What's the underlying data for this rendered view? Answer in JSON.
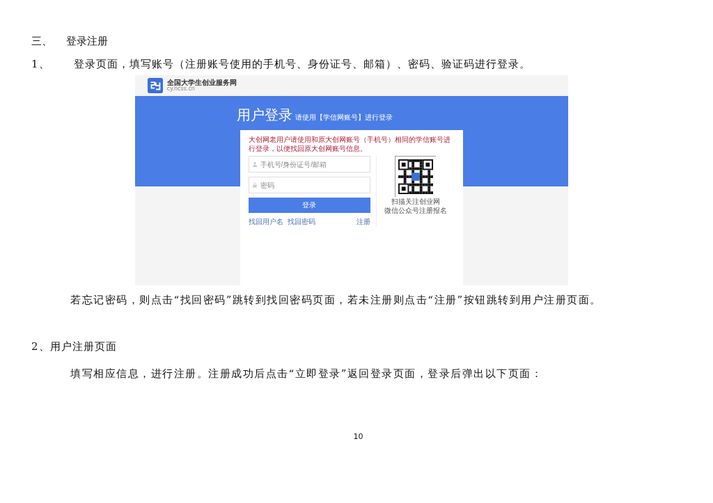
{
  "section": {
    "number": "三、",
    "title": "登录注册"
  },
  "step_1": {
    "number": "1、",
    "text": "登录页面，填写账号（注册账号使用的手机号、身份证号、邮箱）、密码、验证码进行登录。"
  },
  "screenshot": {
    "site_name": "全国大学生创业服务网",
    "site_domain": "cy.ncss.cn",
    "page_title": "用户登录",
    "page_subtitle": "请使用【学信网账号】进行登录",
    "notice": "大创网老用户请使用和原大创网账号（手机号）相同的学信账号进行登录，以便找回原大创网账号信息。",
    "fields": [
      {
        "kind": "user",
        "placeholder": "手机号/身份证号/邮箱"
      },
      {
        "kind": "lock",
        "placeholder": "密码"
      }
    ],
    "login_button": "登录",
    "links": [
      "找回用户名",
      "找回密码"
    ],
    "register_link": "注册",
    "qr_caption": [
      "扫描关注创业网",
      "微信公众号注册报名"
    ]
  },
  "note_1": "若忘记密码，则点击“找回密码”跳转到找回密码页面，若未注册则点击“注册”按钮跳转到用户注册页面。",
  "step_2": {
    "title": "2、用户注册页面",
    "text": "填写相应信息，进行注册。注册成功后点击“立即登录”返回登录页面，登录后弹出以下页面："
  },
  "page_number": "10"
}
